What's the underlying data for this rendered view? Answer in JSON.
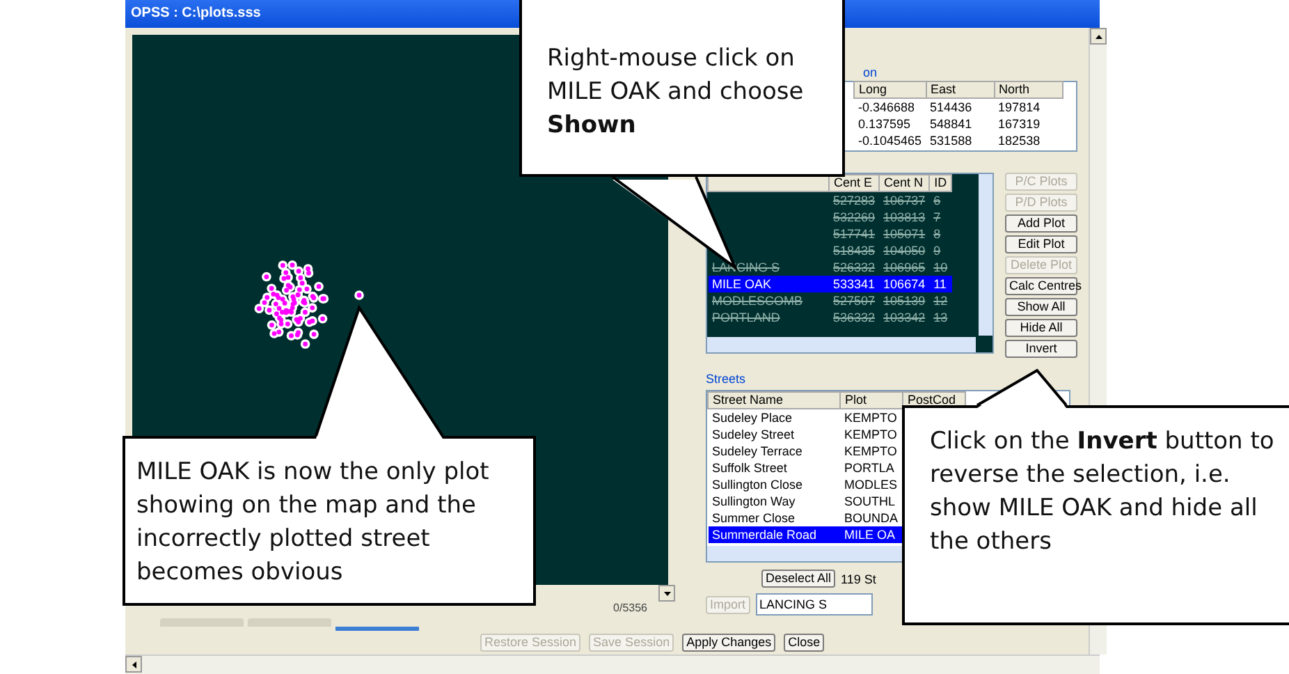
{
  "window": {
    "title": "OPSS : C:\\plots.sss"
  },
  "location": {
    "label": "on",
    "columns": [
      "Long",
      "East",
      "North"
    ],
    "rows": [
      [
        "-0.346688",
        "514436",
        "197814"
      ],
      [
        "0.137595",
        "548841",
        "167319"
      ],
      [
        "-0.1045465",
        "531588",
        "182538"
      ]
    ]
  },
  "plots": {
    "columns": [
      "Cent E",
      "Cent N",
      "ID"
    ],
    "rows": [
      {
        "cells": [
          "527283",
          "106737",
          "6"
        ],
        "hidden": true,
        "selected": false
      },
      {
        "cells": [
          "532269",
          "103813",
          "7"
        ],
        "hidden": true,
        "selected": false
      },
      {
        "cells": [
          "517741",
          "105071",
          "8"
        ],
        "hidden": true,
        "selected": false
      },
      {
        "cells": [
          "518435",
          "104050",
          "9"
        ],
        "hidden": true,
        "selected": false
      },
      {
        "name": "LANCING S",
        "cells": [
          "526332",
          "106965",
          "10"
        ],
        "hidden": true,
        "selected": false
      },
      {
        "name": "MILE OAK",
        "cells": [
          "533341",
          "106674",
          "11"
        ],
        "hidden": false,
        "selected": true
      },
      {
        "name": "MODLESCOMB",
        "cells": [
          "527507",
          "105139",
          "12"
        ],
        "hidden": true,
        "selected": false
      },
      {
        "name": "PORTLAND",
        "cells": [
          "536332",
          "103342",
          "13"
        ],
        "hidden": true,
        "selected": false
      }
    ]
  },
  "plot_buttons": [
    {
      "label": "P/C Plots",
      "disabled": true
    },
    {
      "label": "P/D Plots",
      "disabled": true
    },
    {
      "label": "Add Plot",
      "disabled": false
    },
    {
      "label": "Edit Plot",
      "disabled": false
    },
    {
      "label": "Delete Plot",
      "disabled": true
    },
    {
      "label": "Calc Centres",
      "disabled": false
    },
    {
      "label": "Show All",
      "disabled": false
    },
    {
      "label": "Hide All",
      "disabled": false
    },
    {
      "label": "Invert",
      "disabled": false
    }
  ],
  "streets": {
    "label": "Streets",
    "columns": [
      "Street Name",
      "Plot",
      "PostCod"
    ],
    "rows": [
      {
        "cells": [
          "Sudeley Place",
          "KEMPTO"
        ],
        "selected": false
      },
      {
        "cells": [
          "Sudeley Street",
          "KEMPTO"
        ],
        "selected": false
      },
      {
        "cells": [
          "Sudeley Terrace",
          "KEMPTO"
        ],
        "selected": false
      },
      {
        "cells": [
          "Suffolk Street",
          "PORTLA"
        ],
        "selected": false
      },
      {
        "cells": [
          "Sullington Close",
          "MODLES"
        ],
        "selected": false
      },
      {
        "cells": [
          "Sullington Way",
          "SOUTHL"
        ],
        "selected": false
      },
      {
        "cells": [
          "Summer Close",
          "BOUNDA"
        ],
        "selected": false
      },
      {
        "cells": [
          "Summerdale Road",
          "MILE OA"
        ],
        "selected": true
      }
    ]
  },
  "deselect_button": "Deselect All",
  "street_count": "119 St",
  "import_button": {
    "label": "Import",
    "disabled": true
  },
  "import_field": {
    "value": "LANCING S"
  },
  "status": "0/5356",
  "bottom_tabs": [
    {
      "selected": false
    },
    {
      "selected": false
    },
    {
      "selected": true
    }
  ],
  "bottom_buttons": [
    {
      "label": "Restore Session",
      "disabled": true
    },
    {
      "label": "Save Session",
      "disabled": true
    },
    {
      "label": "Apply Changes",
      "disabled": false
    },
    {
      "label": "Close",
      "disabled": false
    }
  ],
  "callouts": [
    {
      "text": "Right-mouse click on MILE OAK and choose **Shown**"
    },
    {
      "text": "MILE OAK is now the only plot showing on the map and the incorrectly plotted street becomes obvious"
    },
    {
      "text": "Click on the **Invert** button to reverse the selection, i.e. show MILE OAK and hide all the others"
    }
  ]
}
